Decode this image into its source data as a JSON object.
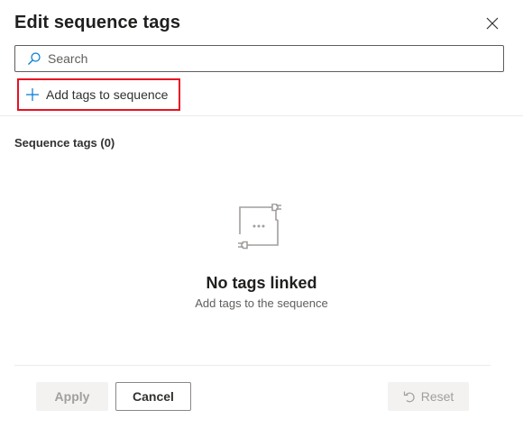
{
  "dialog": {
    "title": "Edit sequence tags"
  },
  "search": {
    "placeholder": "Search",
    "value": ""
  },
  "toolbar": {
    "add_tags_label": "Add tags to sequence"
  },
  "section": {
    "label": "Sequence tags (0)"
  },
  "empty_state": {
    "title": "No tags linked",
    "subtitle": "Add tags to the sequence"
  },
  "footer": {
    "apply_label": "Apply",
    "cancel_label": "Cancel",
    "reset_label": "Reset"
  },
  "icons": {
    "close": "close-icon",
    "search": "search-icon",
    "add": "plus-icon",
    "empty": "plug-link-icon",
    "reset": "undo-icon"
  },
  "colors": {
    "highlight_border": "#e81123",
    "accent": "#0078d4",
    "disabled_bg": "#f3f2f1",
    "disabled_text": "#a19f9d"
  }
}
